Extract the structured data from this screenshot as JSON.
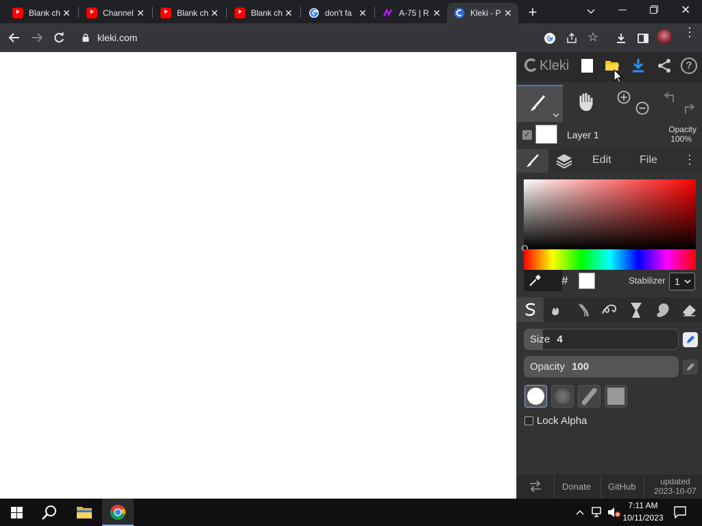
{
  "browser": {
    "tabs": [
      {
        "label": "Blank ch",
        "icon": "youtube-icon"
      },
      {
        "label": "Channel",
        "icon": "youtube-icon"
      },
      {
        "label": "Blank ch",
        "icon": "youtube-icon"
      },
      {
        "label": "Blank ch",
        "icon": "youtube-icon"
      },
      {
        "label": "don't fa",
        "icon": "google-icon"
      },
      {
        "label": "A-75 | R",
        "icon": "site-icon"
      },
      {
        "label": "Kleki - P",
        "icon": "kleki-icon",
        "active": true
      }
    ],
    "new_tab": "+",
    "url": "kleki.com"
  },
  "kleki": {
    "logo": "Kleki",
    "layer": {
      "name": "Layer 1",
      "opacity_label": "Opacity",
      "opacity_value": "100%"
    },
    "tabs": {
      "edit": "Edit",
      "file": "File"
    },
    "color": {
      "hash": "#",
      "stabilizer_label": "Stabilizer",
      "stabilizer_value": "1",
      "hue_colors": [
        "#ff0000",
        "#ffff00",
        "#00ff00",
        "#00ffff",
        "#0000ff",
        "#ff00ff",
        "#ff0000"
      ]
    },
    "size": {
      "label": "Size",
      "value": "4",
      "fraction": 0.12
    },
    "opacity": {
      "label": "Opacity",
      "value": "100",
      "fraction": 1.0
    },
    "lock_alpha": "Lock Alpha",
    "footer": {
      "donate": "Donate",
      "github": "GitHub",
      "updated_label": "updated",
      "updated_date": "2023-10-07"
    }
  },
  "taskbar": {
    "time": "7:11 AM",
    "date": "10/11/2023"
  }
}
